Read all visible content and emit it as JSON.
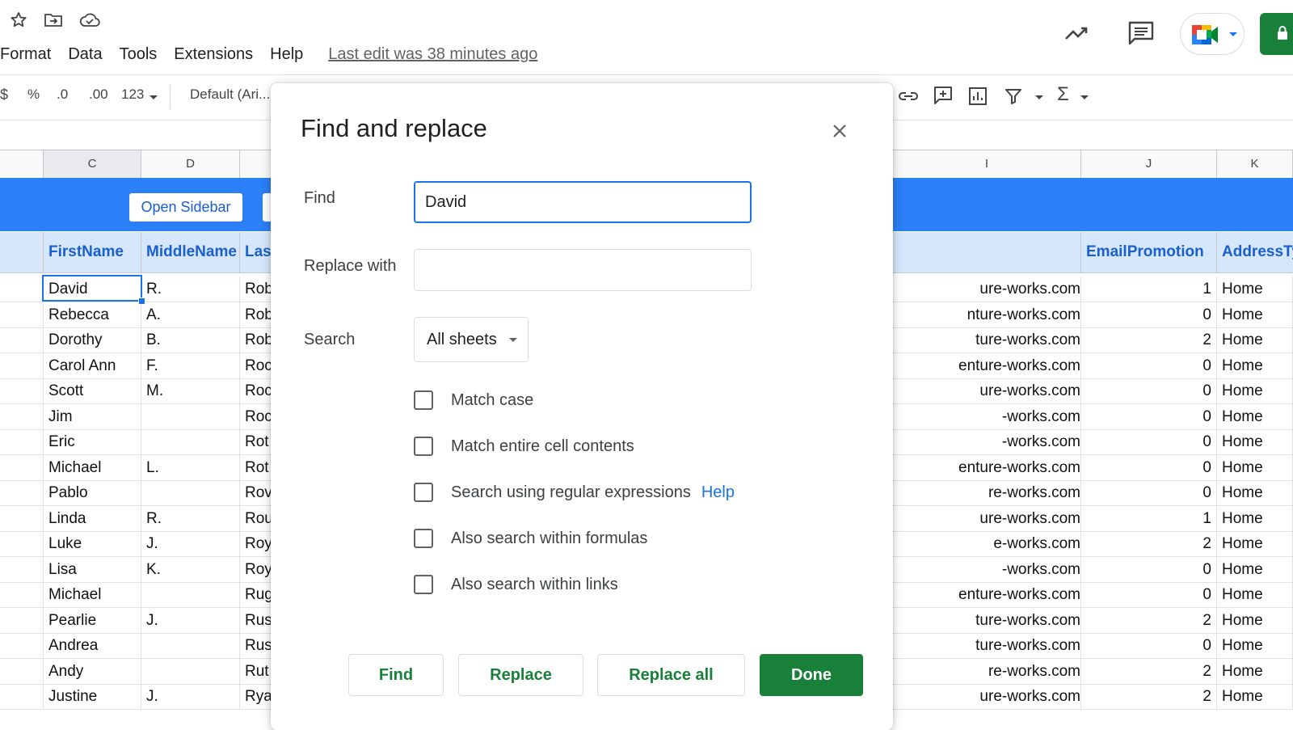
{
  "header": {
    "menu": [
      "Format",
      "Data",
      "Tools",
      "Extensions",
      "Help"
    ],
    "last_edit": "Last edit was 38 minutes ago",
    "icons": [
      "star-icon",
      "move-to-folder-icon",
      "cloud-status-icon",
      "activity-trend-icon",
      "comments-icon",
      "meet-icon",
      "lock-icon"
    ]
  },
  "toolbar": {
    "percent": "%",
    "dec_decrease": ".0",
    "dec_increase": ".00",
    "more_formats": "123",
    "font": "Default (Ari..."
  },
  "grid": {
    "columns_left": [
      "C",
      "D"
    ],
    "columns_right": [
      "I",
      "J",
      "K"
    ],
    "open_sidebar": "Open Sidebar",
    "headers": {
      "c": "FirstName",
      "d": "MiddleName",
      "e": "Las",
      "j": "EmailPromotion",
      "k": "AddressTy"
    },
    "rows": [
      {
        "first": "David",
        "middle": "R.",
        "last": "Rob",
        "email": "ure-works.com",
        "promo": "1",
        "addr": "Home"
      },
      {
        "first": "Rebecca",
        "middle": "A.",
        "last": "Rob",
        "email": "nture-works.com",
        "promo": "0",
        "addr": "Home"
      },
      {
        "first": "Dorothy",
        "middle": "B.",
        "last": "Rob",
        "email": "ture-works.com",
        "promo": "2",
        "addr": "Home"
      },
      {
        "first": "Carol Ann",
        "middle": "F.",
        "last": "Roc",
        "email": "enture-works.com",
        "promo": "0",
        "addr": "Home"
      },
      {
        "first": "Scott",
        "middle": "M.",
        "last": "Roc",
        "email": "ure-works.com",
        "promo": "0",
        "addr": "Home"
      },
      {
        "first": "Jim",
        "middle": "",
        "last": "Roc",
        "email": "-works.com",
        "promo": "0",
        "addr": "Home"
      },
      {
        "first": "Eric",
        "middle": "",
        "last": "Rot",
        "email": "-works.com",
        "promo": "0",
        "addr": "Home"
      },
      {
        "first": "Michael",
        "middle": "L.",
        "last": "Rot",
        "email": "enture-works.com",
        "promo": "0",
        "addr": "Home"
      },
      {
        "first": "Pablo",
        "middle": "",
        "last": "Rov",
        "email": "re-works.com",
        "promo": "0",
        "addr": "Home"
      },
      {
        "first": "Linda",
        "middle": "R.",
        "last": "Rou",
        "email": "ure-works.com",
        "promo": "1",
        "addr": "Home"
      },
      {
        "first": "Luke",
        "middle": "J.",
        "last": "Roy",
        "email": "e-works.com",
        "promo": "2",
        "addr": "Home"
      },
      {
        "first": "Lisa",
        "middle": "K.",
        "last": "Roy",
        "email": "-works.com",
        "promo": "0",
        "addr": "Home"
      },
      {
        "first": "Michael",
        "middle": "",
        "last": "Rug",
        "email": "enture-works.com",
        "promo": "0",
        "addr": "Home"
      },
      {
        "first": "Pearlie",
        "middle": "J.",
        "last": "Rus",
        "email": "ture-works.com",
        "promo": "2",
        "addr": "Home"
      },
      {
        "first": "Andrea",
        "middle": "",
        "last": "Rus",
        "email": "ture-works.com",
        "promo": "0",
        "addr": "Home"
      },
      {
        "first": "Andy",
        "middle": "",
        "last": "Rut",
        "email": "re-works.com",
        "promo": "2",
        "addr": "Home"
      },
      {
        "first": "Justine",
        "middle": "J.",
        "last": "Rya",
        "email": "ure-works.com",
        "promo": "2",
        "addr": "Home"
      }
    ]
  },
  "dialog": {
    "title": "Find and replace",
    "find_label": "Find",
    "find_value": "David",
    "replace_label": "Replace with",
    "replace_value": "",
    "search_label": "Search",
    "search_scope": "All sheets",
    "options": [
      {
        "label": "Match case",
        "checked": false
      },
      {
        "label": "Match entire cell contents",
        "checked": false
      },
      {
        "label": "Search using regular expressions",
        "checked": false,
        "help": "Help"
      },
      {
        "label": "Also search within formulas",
        "checked": false
      },
      {
        "label": "Also search within links",
        "checked": false
      }
    ],
    "buttons": {
      "find": "Find",
      "replace": "Replace",
      "replace_all": "Replace all",
      "done": "Done"
    }
  },
  "colors": {
    "accent_green": "#188038",
    "accent_blue": "#1a73e8",
    "band_blue": "#2b7ff7"
  }
}
